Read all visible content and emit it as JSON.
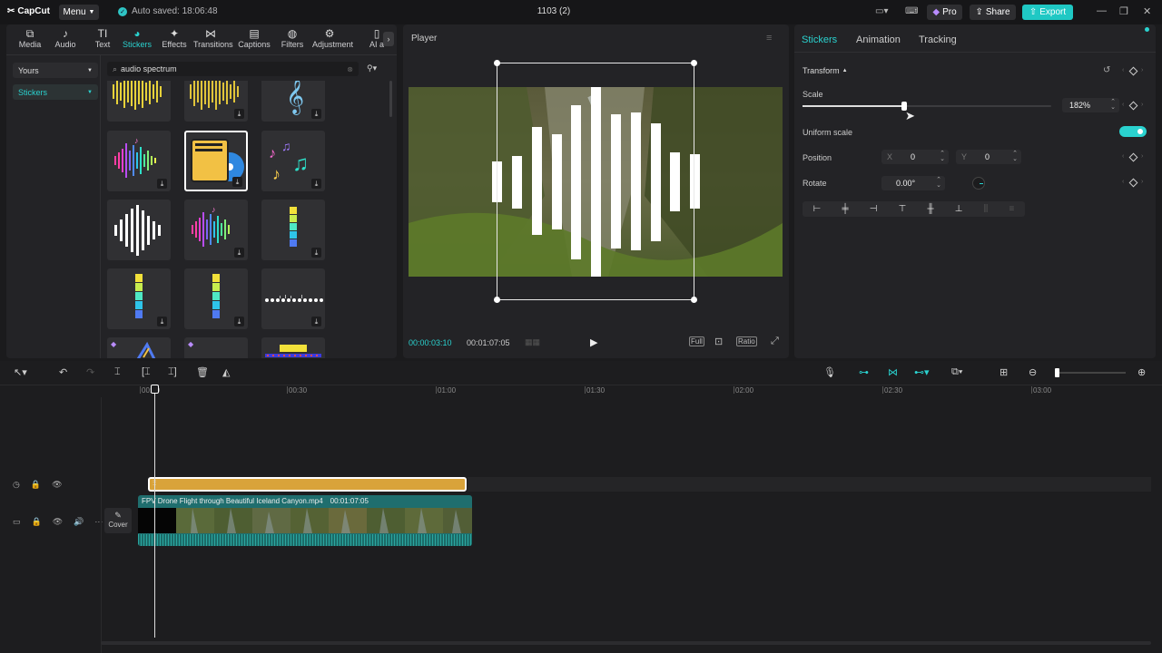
{
  "app": {
    "name": "CapCut",
    "menu_label": "Menu",
    "autosave": "Auto saved: 18:06:48",
    "project_title": "1103 (2)"
  },
  "topbar": {
    "pro_label": "Pro",
    "share_label": "Share",
    "export_label": "Export"
  },
  "toolbar": {
    "tools": [
      {
        "label": "Media",
        "icon": "media-icon"
      },
      {
        "label": "Audio",
        "icon": "audio-icon"
      },
      {
        "label": "Text",
        "icon": "text-icon"
      },
      {
        "label": "Stickers",
        "icon": "stickers-icon",
        "active": true
      },
      {
        "label": "Effects",
        "icon": "effects-icon"
      },
      {
        "label": "Transitions",
        "icon": "transitions-icon"
      },
      {
        "label": "Captions",
        "icon": "captions-icon"
      },
      {
        "label": "Filters",
        "icon": "filters-icon"
      },
      {
        "label": "Adjustment",
        "icon": "adjustment-icon"
      },
      {
        "label": "AI a",
        "icon": "ai-icon"
      }
    ]
  },
  "sidebar": {
    "yours_label": "Yours",
    "stickers_label": "Stickers"
  },
  "search": {
    "value": "audio spectrum"
  },
  "player": {
    "title": "Player",
    "current_time": "00:00:03:10",
    "duration": "00:01:07:05",
    "full_label": "Full",
    "ratio_label": "Ratio"
  },
  "properties": {
    "tabs": [
      "Stickers",
      "Animation",
      "Tracking"
    ],
    "transform_label": "Transform",
    "scale_label": "Scale",
    "scale_value": "182%",
    "scale_fraction": 0.41,
    "uniform_scale_label": "Uniform scale",
    "uniform_scale_on": true,
    "position_label": "Position",
    "x_label": "X",
    "x_value": "0",
    "y_label": "Y",
    "y_value": "0",
    "rotate_label": "Rotate",
    "rotate_value": "0.00°"
  },
  "timeline": {
    "ticks": [
      "00:00",
      "00:30",
      "01:00",
      "01:30",
      "02:00",
      "02:30",
      "03:00"
    ],
    "clip_name": "FPV Drone Flight through Beautiful Iceland Canyon.mp4",
    "clip_duration": "00:01:07:05",
    "cover_label": "Cover"
  },
  "colors": {
    "accent": "#2ad2cf",
    "sticker_clip": "#d9a33a",
    "video_clip": "#1f6e6e"
  }
}
